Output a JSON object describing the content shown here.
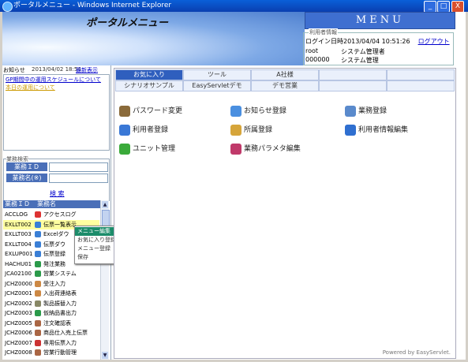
{
  "window": {
    "title": "ポータルメニュー - Windows Internet Explorer",
    "buttons": [
      "_",
      "□",
      "X"
    ]
  },
  "banner": {
    "title": "ポータルメニュー"
  },
  "menu_header": "MENU",
  "user_info": {
    "legend": "利用者情報",
    "login_label": "ログイン日時",
    "login_time": "2013/04/04 10:51:26",
    "logout": "ログアウト",
    "user_id": "root",
    "user_role": "システム管理者",
    "group_id": "000000",
    "group_name": "システム管理"
  },
  "notice": {
    "label": "お知らせ",
    "date": "2013/04/02 18:54",
    "latest_link": "最新表示",
    "items": [
      "GP期間中の運用スケジュールについて",
      "本日の運用について"
    ]
  },
  "search": {
    "legend": "業務検索",
    "id_label": "業務ＩＤ",
    "name_label": "業務名(※)",
    "button": "検 索"
  },
  "grid": {
    "headers": [
      "業務ＩＤ",
      "業務名"
    ],
    "rows": [
      {
        "id": "ACCLOG",
        "name": "アクセスログ",
        "icon_color": "#d33"
      },
      {
        "id": "EXLLT002",
        "name": "伝票一覧表示",
        "icon_color": "#3a7fd6"
      },
      {
        "id": "EXLLT003",
        "name": "Excelダウ",
        "icon_color": "#3a7fd6"
      },
      {
        "id": "EXLLT004",
        "name": "伝票ダウ",
        "icon_color": "#3a7fd6"
      },
      {
        "id": "EXLUP001",
        "name": "伝票登録",
        "icon_color": "#3a7fd6"
      },
      {
        "id": "HACHU01",
        "name": "発注業務",
        "icon_color": "#2a9a4a"
      },
      {
        "id": "JCA02100",
        "name": "営業システム",
        "icon_color": "#2a9a4a"
      },
      {
        "id": "JCHZ0000",
        "name": "受注入力",
        "icon_color": "#c84"
      },
      {
        "id": "JCHZ0001",
        "name": "入出荷連絡表",
        "icon_color": "#c84"
      },
      {
        "id": "JCHZ0002",
        "name": "製品振替入力",
        "icon_color": "#886"
      },
      {
        "id": "JCHZ0003",
        "name": "仮納品書出力",
        "icon_color": "#2a9a4a"
      },
      {
        "id": "JCHZ0005",
        "name": "注文確認表",
        "icon_color": "#a64"
      },
      {
        "id": "JCHZ0006",
        "name": "商品仕入売上伝票",
        "icon_color": "#a64"
      },
      {
        "id": "JCHZ0007",
        "name": "専用伝票入力",
        "icon_color": "#c33"
      },
      {
        "id": "JCHZ0008",
        "name": "営業行動管理",
        "icon_color": "#a64"
      }
    ],
    "selected_row": 1
  },
  "context_menu": {
    "items": [
      "メニュー編集",
      "お気に入り登録",
      "メニュー登録",
      "保存"
    ],
    "highlighted": 0
  },
  "tabs": {
    "row1": [
      "お気に入り",
      "ツール",
      "A社様",
      "",
      "",
      ""
    ],
    "row2": [
      "シナリオサンプル",
      "EasyServletデモ",
      "デモ営業",
      "",
      "",
      ""
    ],
    "active": "お気に入り"
  },
  "functions": [
    {
      "label": "パスワード変更",
      "icon": "key-icon",
      "color": "#8a6a3a"
    },
    {
      "label": "お知らせ登録",
      "icon": "info-bubble-icon",
      "color": "#4a8fe0"
    },
    {
      "label": "業務登録",
      "icon": "edit-icon",
      "color": "#5a8acc"
    },
    {
      "label": "利用者登録",
      "icon": "user-icon",
      "color": "#3a78d6"
    },
    {
      "label": "所属登録",
      "icon": "group-icon",
      "color": "#d6a53a"
    },
    {
      "label": "利用者情報編集",
      "icon": "info-icon",
      "color": "#2f6fd0"
    },
    {
      "label": "ユニット管理",
      "icon": "unit-icon",
      "color": "#3aaa3a"
    },
    {
      "label": "業務パラメタ編集",
      "icon": "parameter-icon",
      "color": "#c0396a"
    }
  ],
  "footer": "Powered by EasyServlet."
}
